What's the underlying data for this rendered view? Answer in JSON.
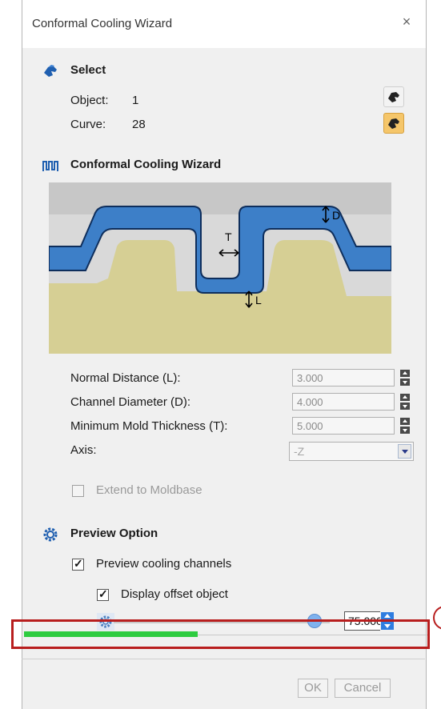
{
  "dialog": {
    "title": "Conformal Cooling Wizard",
    "close_glyph": "×"
  },
  "select_section": {
    "title": "Select",
    "object_label": "Object:",
    "object_value": "1",
    "curve_label": "Curve:",
    "curve_value": "28"
  },
  "wizard_section": {
    "title": "Conformal Cooling Wizard",
    "diagram_labels": {
      "d": "D",
      "t": "T",
      "l": "L"
    },
    "fields": [
      {
        "label": "Normal Distance (L):",
        "value": "3.000"
      },
      {
        "label": "Channel Diameter (D):",
        "value": "4.000"
      },
      {
        "label": "Minimum Mold Thickness (T):",
        "value": "5.000"
      }
    ],
    "axis_label": "Axis:",
    "axis_value": "-Z",
    "extend_label": "Extend to Moldbase",
    "extend_checked": false
  },
  "preview_section": {
    "title": "Preview Option",
    "preview_channels_label": "Preview cooling channels",
    "preview_channels_checked": true,
    "display_offset_label": "Display offset object",
    "display_offset_checked": true,
    "transparency_value": "75.000",
    "slider_level": 0.93
  },
  "progress": {
    "fraction": 0.43
  },
  "buttons": {
    "ok": "OK",
    "cancel": "Cancel"
  },
  "colors": {
    "channel_blue": "#3d7fc8",
    "mold_tan": "#d6cf94",
    "progress_green": "#2ecc40",
    "highlight_red": "#b81e1e"
  }
}
